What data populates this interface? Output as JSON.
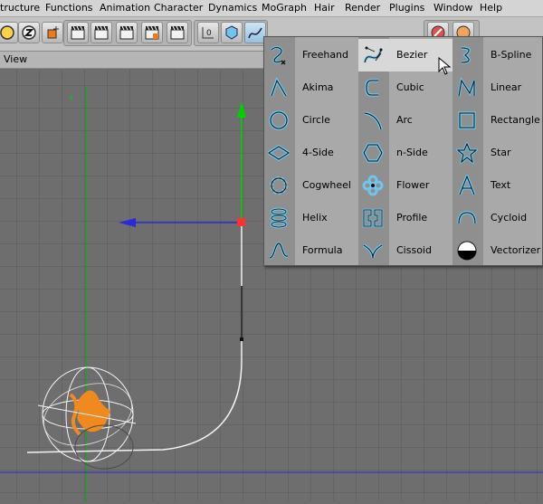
{
  "menubar": {
    "items": [
      "tructure",
      "Functions",
      "Animation",
      "Character",
      "Dynamics",
      "MoGraph",
      "Hair",
      "Render",
      "Plugins",
      "Window",
      "Help"
    ]
  },
  "view": {
    "title": "View"
  },
  "viewport": {
    "axis_label": "Y"
  },
  "spline_menu": {
    "items": [
      {
        "label": "Freehand",
        "icon": "freehand-icon"
      },
      {
        "label": "Akima",
        "icon": "akima-icon"
      },
      {
        "label": "Circle",
        "icon": "circle-icon"
      },
      {
        "label": "4-Side",
        "icon": "four-side-icon"
      },
      {
        "label": "Cogwheel",
        "icon": "cogwheel-icon"
      },
      {
        "label": "Helix",
        "icon": "helix-icon"
      },
      {
        "label": "Formula",
        "icon": "formula-icon"
      },
      {
        "label": "Bezier",
        "icon": "bezier-icon",
        "highlighted": true
      },
      {
        "label": "Cubic",
        "icon": "cubic-icon"
      },
      {
        "label": "Arc",
        "icon": "arc-icon"
      },
      {
        "label": "n-Side",
        "icon": "n-side-icon"
      },
      {
        "label": "Flower",
        "icon": "flower-icon"
      },
      {
        "label": "Profile",
        "icon": "profile-icon"
      },
      {
        "label": "Cissoid",
        "icon": "cissoid-icon"
      },
      {
        "label": "B-Spline",
        "icon": "b-spline-icon"
      },
      {
        "label": "Linear",
        "icon": "linear-icon"
      },
      {
        "label": "Rectangle",
        "icon": "rectangle-icon"
      },
      {
        "label": "Star",
        "icon": "star-icon"
      },
      {
        "label": "Text",
        "icon": "text-icon"
      },
      {
        "label": "Cycloid",
        "icon": "cycloid-icon"
      },
      {
        "label": "Vectorizer",
        "icon": "vectorizer-icon"
      }
    ]
  },
  "colors": {
    "icon_blue": "#6ec6ee",
    "axis_green": "#00c800",
    "axis_blue": "#2a2ad8",
    "axis_red": "#ff3030",
    "figure_orange": "#f08a1e"
  }
}
